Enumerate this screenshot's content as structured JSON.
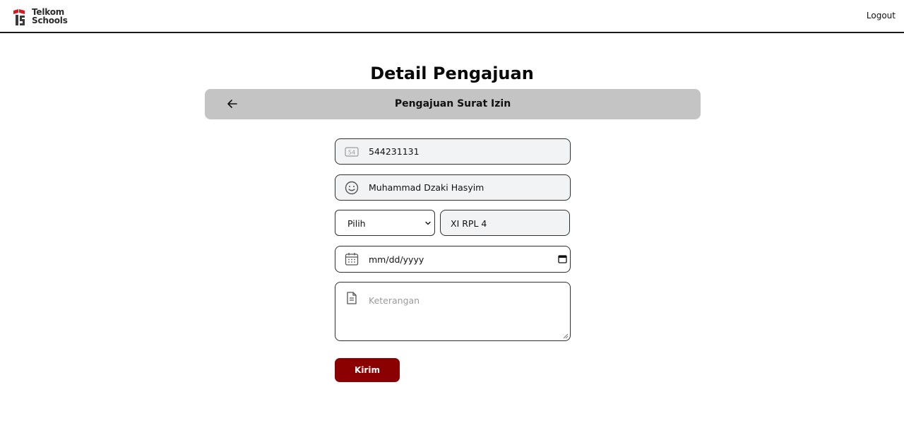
{
  "header": {
    "logo_line1": "Telkom",
    "logo_line2": "Schools",
    "logout_label": "Logout"
  },
  "page": {
    "title": "Detail Pengajuan",
    "subheader_title": "Pengajuan Surat Izin"
  },
  "form": {
    "nis_value": "544231131",
    "nis_icon_text": "54",
    "name_value": "Muhammad Dzaki Hasyim",
    "select_value": "Pilih",
    "kelas_value": "XI RPL 4",
    "date_placeholder": "mm/dd/yyyy",
    "keterangan_placeholder": "Keterangan",
    "submit_label": "Kirim"
  },
  "icons": {
    "nis": "id-number-icon",
    "name": "smiley-face-icon",
    "date": "calendar-icon",
    "keterangan": "document-icon",
    "back": "arrow-left-icon"
  },
  "colors": {
    "brand_red": "#8b0000",
    "subheader_bg": "#c4c4c4",
    "field_bg": "#f2f3f5"
  }
}
